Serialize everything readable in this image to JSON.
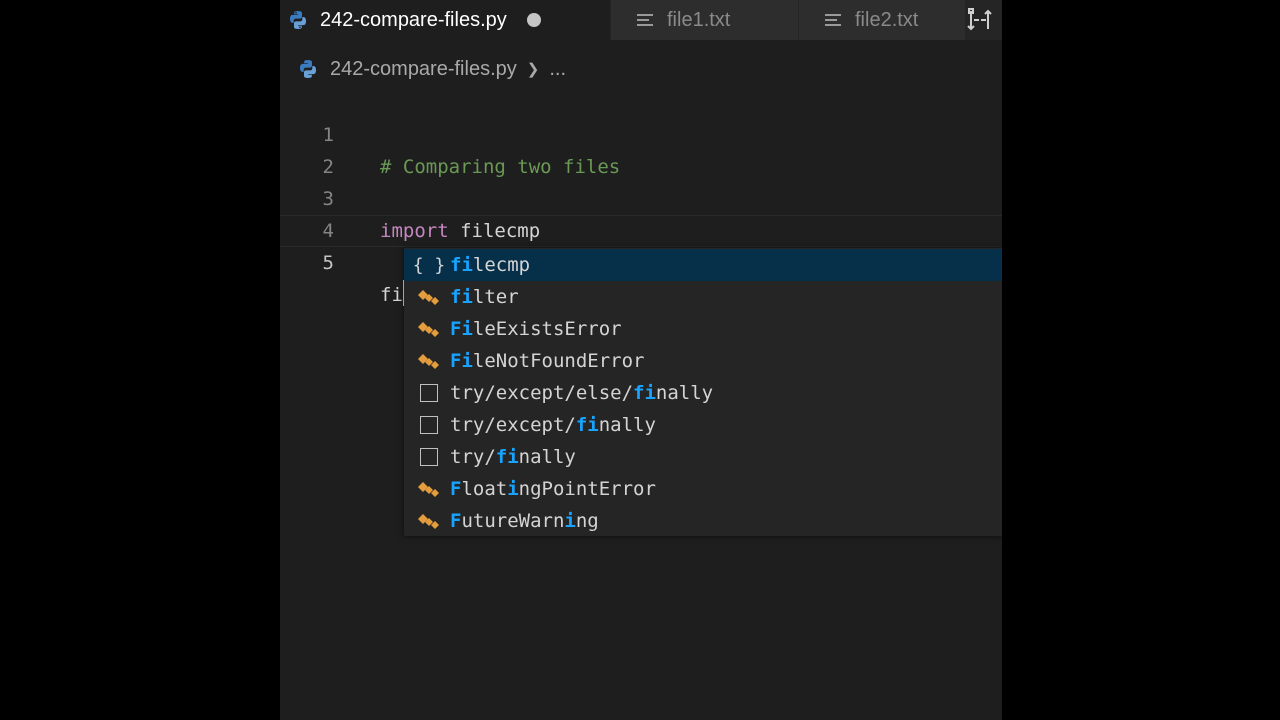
{
  "tabs": [
    {
      "label": "242-compare-files.py",
      "icon": "python-icon",
      "active": true,
      "dirty": true
    },
    {
      "label": "file1.txt",
      "icon": "text-file-icon",
      "active": false
    },
    {
      "label": "file2.txt",
      "icon": "text-file-icon",
      "active": false
    }
  ],
  "breadcrumb": {
    "file": "242-compare-files.py",
    "rest": "..."
  },
  "code": {
    "lines": [
      {
        "number": "1",
        "text": "# Comparing two files",
        "kind": "comment"
      },
      {
        "number": "2",
        "text": "",
        "kind": "blank"
      },
      {
        "number": "3",
        "keyword": "import",
        "ident": " filecmp",
        "kind": "import"
      },
      {
        "number": "4",
        "text": "",
        "kind": "blank"
      },
      {
        "number": "5",
        "text": "fi",
        "kind": "typing"
      }
    ]
  },
  "suggestions": [
    {
      "kind": "module",
      "match": "fi",
      "rest": "lecmp",
      "selected": true
    },
    {
      "kind": "class",
      "match": "fi",
      "rest": "lter"
    },
    {
      "kind": "class",
      "match": "Fi",
      "rest": "leExistsError"
    },
    {
      "kind": "class",
      "match": "Fi",
      "rest": "leNotFoundError"
    },
    {
      "kind": "snippet",
      "pre": "try/except/else/",
      "match": "fi",
      "rest": "nally"
    },
    {
      "kind": "snippet",
      "pre": "try/except/",
      "match": "fi",
      "rest": "nally"
    },
    {
      "kind": "snippet",
      "pre": "try/",
      "match": "fi",
      "rest": "nally"
    },
    {
      "kind": "class",
      "match": "F",
      "mid": "loat",
      "match2": "i",
      "rest": "ngPointError"
    },
    {
      "kind": "class",
      "match": "F",
      "mid": "utureWarn",
      "match2": "i",
      "rest": "ng"
    }
  ],
  "colors": {
    "editor_bg": "#1e1e1e",
    "selection": "#062f4a",
    "match_highlight": "#18a3ff",
    "comment": "#6a9955",
    "keyword": "#c586c0"
  },
  "module_icon_glyph": "{ }"
}
